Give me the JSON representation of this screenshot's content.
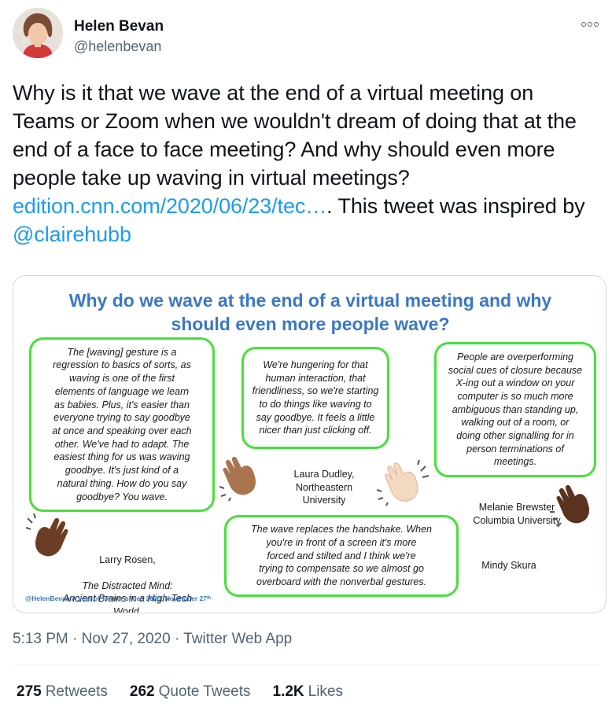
{
  "author": {
    "name": "Helen Bevan",
    "handle": "@helenbevan"
  },
  "tweet": {
    "text_before": "Why is it that we wave at the end of a virtual meeting on Teams or Zoom when we wouldn't dream of doing that at the end of a face to face meeting? And why should even more people take up waving in virtual meetings? ",
    "link": "edition.cnn.com/2020/06/23/tec…",
    "text_middle": ". This tweet was inspired by ",
    "mention": "@clairehubb"
  },
  "slide": {
    "title_line1": "Why do we wave at the end of a virtual meeting and why",
    "title_line2": "should even more people wave?",
    "quotes": {
      "rosen": "The [waving] gesture is a\nregression to basics of sorts, as\nwaving is one of the first\nelements of language we learn\nas babies. Plus, it's easier than\neveryone trying to say goodbye\nat once and speaking over each\nother. We've had to adapt. The\neasiest thing for us was waving\ngoodbye. It's just kind of a\nnatural thing. How do you say\ngoodbye? You wave.",
      "dudley": "We're hungering for that\nhuman interaction, that\nfriendliness, so we're starting\nto do things like waving to\nsay goodbye. It feels a little\nnicer than just clicking off.",
      "brewster": "People are overperforming\nsocial cues of closure because\nX-ing out a window on your\ncomputer is so much more\nambiguous than standing up,\nwalking out of a room, or\ndoing other signalling for in\nperson terminations of\nmeetings.",
      "skura": "The wave replaces the handshake. When\nyou're in front of a screen it's more\nforced and stilted and I think we're\ntrying to compensate so we almost go\noverboard with the nonverbal gestures."
    },
    "speakers": {
      "rosen_name": "Larry Rosen,",
      "rosen_book": "The Distracted Mind:\nAncient Brains in a High-Tech\nWorld.",
      "dudley": "Laura Dudley,\nNortheastern\nUniversity",
      "brewster": "Melanie Brewster\nColumbia University",
      "skura": "Mindy Skura"
    },
    "footer": "@HelenBevan A year of Twitter slides 2020: November 27ᵗʰ",
    "colors": {
      "title": "#3a78c4",
      "bubble_border": "#47e03a"
    },
    "icons": [
      "waving-hand-dark-icon",
      "waving-hand-medium-icon",
      "waving-hand-light-icon",
      "waving-hand-dark-icon"
    ]
  },
  "meta": {
    "time": "5:13 PM",
    "separator1": " · ",
    "date": "Nov 27, 2020",
    "separator2": " · ",
    "app": "Twitter Web App"
  },
  "stats": {
    "retweets_count": "275",
    "retweets_label": "Retweets",
    "quotes_count": "262",
    "quotes_label": "Quote Tweets",
    "likes_count": "1.2K",
    "likes_label": "Likes"
  },
  "colors": {
    "link": "#1d9bf0",
    "secondary_text": "#536471"
  }
}
